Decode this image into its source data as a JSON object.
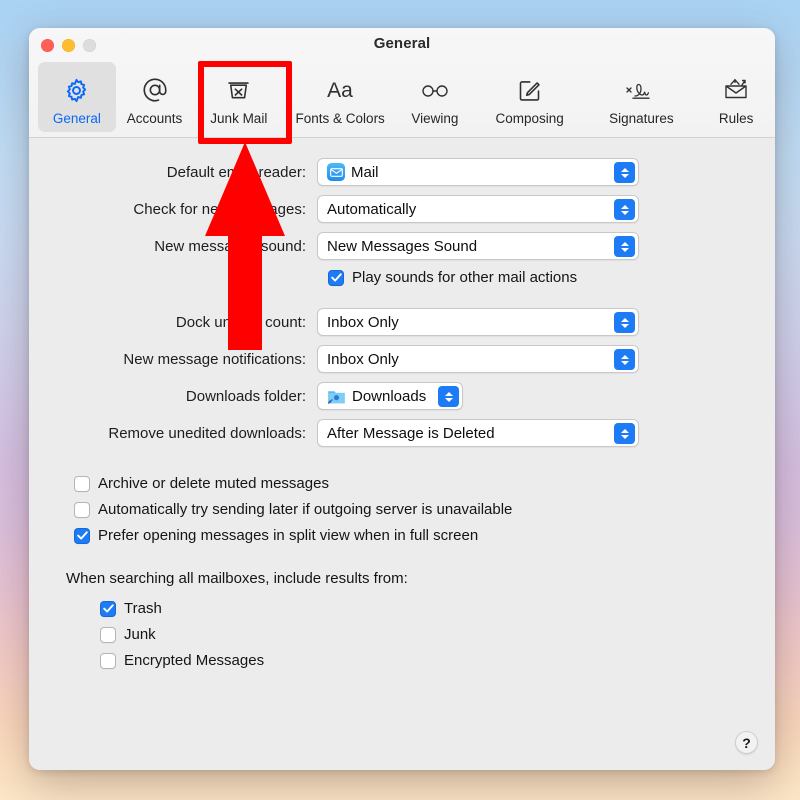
{
  "window": {
    "title": "General",
    "traffic_lights": [
      "close",
      "minimize",
      "zoom"
    ]
  },
  "toolbar": {
    "items": [
      {
        "label": "General",
        "icon": "gear-icon",
        "selected": true
      },
      {
        "label": "Accounts",
        "icon": "at-sign-icon",
        "selected": false
      },
      {
        "label": "Junk Mail",
        "icon": "trash-x-icon",
        "selected": false
      },
      {
        "label": "Fonts & Colors",
        "icon": "aa-text-icon",
        "selected": false
      },
      {
        "label": "Viewing",
        "icon": "glasses-icon",
        "selected": false
      },
      {
        "label": "Composing",
        "icon": "compose-pencil-icon",
        "selected": false
      },
      {
        "label": "Signatures",
        "icon": "signature-icon",
        "selected": false
      },
      {
        "label": "Rules",
        "icon": "envelope-rules-icon",
        "selected": false
      }
    ]
  },
  "settings": {
    "rows": [
      {
        "label": "Default email reader:",
        "value": "Mail",
        "icon": "mail-app-icon"
      },
      {
        "label": "Check for new messages:",
        "value": "Automatically",
        "icon": null
      },
      {
        "label": "New messages sound:",
        "value": "New Messages Sound",
        "icon": null
      },
      {
        "label": "Dock unread count:",
        "value": "Inbox Only",
        "icon": null
      },
      {
        "label": "New message notifications:",
        "value": "Inbox Only",
        "icon": null
      },
      {
        "label": "Downloads folder:",
        "value": "Downloads",
        "icon": "downloads-folder-icon"
      },
      {
        "label": "Remove unedited downloads:",
        "value": "After Message is Deleted",
        "icon": null
      }
    ],
    "play_sounds": {
      "label": "Play sounds for other mail actions",
      "checked": true
    },
    "options": [
      {
        "label": "Archive or delete muted messages",
        "checked": false
      },
      {
        "label": "Automatically try sending later if outgoing server is unavailable",
        "checked": false
      },
      {
        "label": "Prefer opening messages in split view when in full screen",
        "checked": true
      }
    ],
    "search_scope_label": "When searching all mailboxes, include results from:",
    "search_scope": [
      {
        "label": "Trash",
        "checked": true
      },
      {
        "label": "Junk",
        "checked": false
      },
      {
        "label": "Encrypted Messages",
        "checked": false
      }
    ]
  },
  "help_button": {
    "label": "?"
  },
  "annotation": {
    "highlight_target": "Junk Mail",
    "shape": "rectangle-with-up-arrow",
    "color": "#fe0000"
  },
  "colors": {
    "accent": "#1d7bf5",
    "selected_tab_text": "#0a68f5",
    "window_bg": "#ececec",
    "titlebar_bg": "#f4f4f4",
    "annotation": "#fe0000"
  }
}
